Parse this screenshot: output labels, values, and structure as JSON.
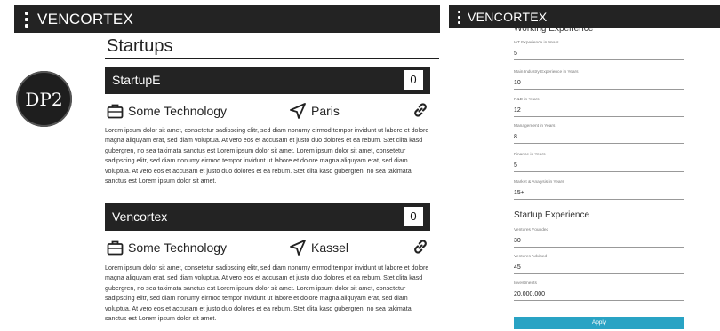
{
  "app": {
    "brand": "VENCORTEX"
  },
  "badge": {
    "label": "DP2"
  },
  "startups": {
    "title": "Startups",
    "cards": [
      {
        "name": "StartupE",
        "count": "0",
        "technology": "Some Technology",
        "location": "Paris",
        "description": "Lorem ipsum dolor sit amet, consetetur sadipscing elitr, sed diam nonumy eirmod tempor invidunt ut labore et dolore magna aliquyam erat, sed diam voluptua. At vero eos et accusam et justo duo dolores et ea rebum. Stet clita kasd gubergren, no sea takimata sanctus est Lorem ipsum dolor sit amet. Lorem ipsum dolor sit amet, consetetur sadipscing elitr, sed diam nonumy eirmod tempor invidunt ut labore et dolore magna aliquyam erat, sed diam voluptua. At vero eos et accusam et justo duo dolores et ea rebum. Stet clita kasd gubergren, no sea takimata sanctus est Lorem ipsum dolor sit amet."
      },
      {
        "name": "Vencortex",
        "count": "0",
        "technology": "Some Technology",
        "location": "Kassel",
        "description": "Lorem ipsum dolor sit amet, consetetur sadipscing elitr, sed diam nonumy eirmod tempor invidunt ut labore et dolore magna aliquyam erat, sed diam voluptua. At vero eos et accusam et justo duo dolores et ea rebum. Stet clita kasd gubergren, no sea takimata sanctus est Lorem ipsum dolor sit amet. Lorem ipsum dolor sit amet, consetetur sadipscing elitr, sed diam nonumy eirmod tempor invidunt ut labore et dolore magna aliquyam erat, sed diam voluptua. At vero eos et accusam et justo duo dolores et ea rebum. Stet clita kasd gubergren, no sea takimata sanctus est Lorem ipsum dolor sit amet."
      }
    ]
  },
  "profile": {
    "working_title": "Working Experience",
    "working_fields": [
      {
        "label": "IoT Experience in Years",
        "value": "5"
      },
      {
        "label": "Main Industry Experience in Years",
        "value": "10"
      },
      {
        "label": "R&D in Years",
        "value": "12"
      },
      {
        "label": "Management in Years",
        "value": "8"
      },
      {
        "label": "Finance in Years",
        "value": "5"
      },
      {
        "label": "Market & Analysis in Years",
        "value": "15+"
      }
    ],
    "startup_title": "Startup Experience",
    "startup_fields": [
      {
        "label": "Ventures Founded",
        "value": "30"
      },
      {
        "label": "Ventures Advised",
        "value": "45"
      },
      {
        "label": "Investments",
        "value": "20.000.000"
      }
    ],
    "apply_label": "Apply"
  },
  "icons": {
    "technology": "briefcase-icon",
    "location": "navigation-arrow-icon",
    "link": "link-icon",
    "menu": "menu-dots-icon"
  }
}
